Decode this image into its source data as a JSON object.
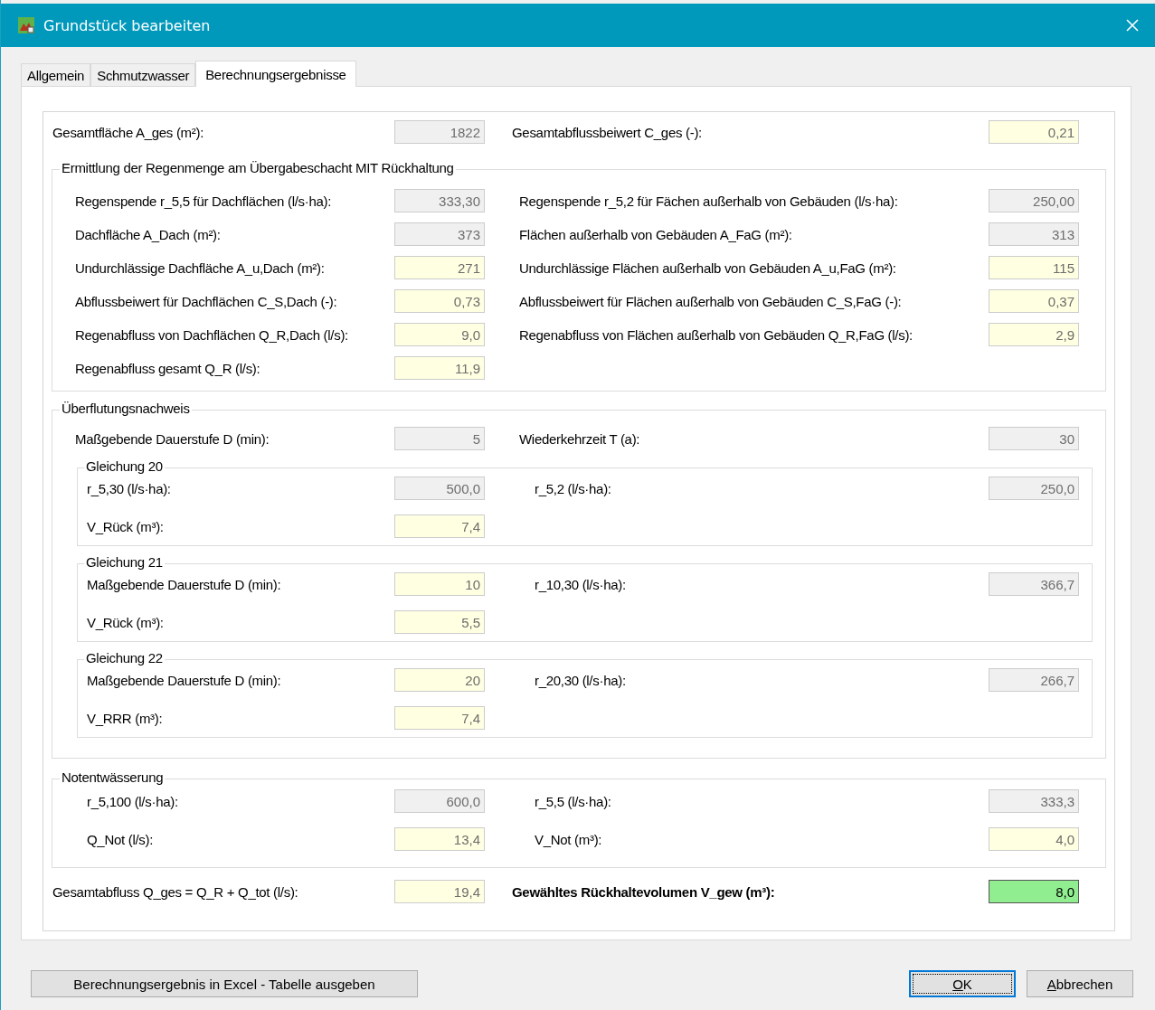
{
  "window": {
    "title": "Grundstück bearbeiten"
  },
  "tabs": [
    {
      "label": "Allgemein",
      "selected": false
    },
    {
      "label": "Schmutzwasser",
      "selected": false
    },
    {
      "label": "Berechnungsergebnisse",
      "selected": true
    }
  ],
  "summary": {
    "left": {
      "label": "Gesamtfläche A_ges (m²):",
      "value": "1822",
      "kind": "readonly"
    },
    "right": {
      "label": "Gesamtabflussbeiwert C_ges (-):",
      "value": "0,21",
      "kind": "computed"
    }
  },
  "rain_section": {
    "title": "Ermittlung der Regenmenge am Übergabeschacht MIT Rückhaltung",
    "rows": [
      {
        "left": {
          "label": "Regenspende r_5,5 für Dachflächen (l/s·ha):",
          "value": "333,30",
          "kind": "readonly"
        },
        "right": {
          "label": "Regenspende r_5,2 für Fächen außerhalb von Gebäuden (l/s·ha):",
          "value": "250,00",
          "kind": "readonly"
        }
      },
      {
        "left": {
          "label": "Dachfläche A_Dach (m²):",
          "value": "373",
          "kind": "readonly"
        },
        "right": {
          "label": "Flächen außerhalb von Gebäuden A_FaG (m²):",
          "value": "313",
          "kind": "readonly"
        }
      },
      {
        "left": {
          "label": "Undurchlässige Dachfläche A_u,Dach (m²):",
          "value": "271",
          "kind": "computed"
        },
        "right": {
          "label": "Undurchlässige Flächen außerhalb von Gebäuden A_u,FaG (m²):",
          "value": "115",
          "kind": "computed"
        }
      },
      {
        "left": {
          "label": "Abflussbeiwert für Dachflächen C_S,Dach (-):",
          "value": "0,73",
          "kind": "computed"
        },
        "right": {
          "label": "Abflussbeiwert für Flächen außerhalb von Gebäuden C_S,FaG (-):",
          "value": "0,37",
          "kind": "computed"
        }
      },
      {
        "left": {
          "label": "Regenabfluss von Dachflächen Q_R,Dach (l/s):",
          "value": "9,0",
          "kind": "computed"
        },
        "right": {
          "label": "Regenabfluss von Flächen außerhalb von Gebäuden Q_R,FaG (l/s):",
          "value": "2,9",
          "kind": "computed"
        }
      },
      {
        "left": {
          "label": "Regenabfluss gesamt Q_R (l/s):",
          "value": "11,9",
          "kind": "computed"
        }
      }
    ]
  },
  "flood_section": {
    "title": "Überflutungsnachweis",
    "top": {
      "left": {
        "label": "Maßgebende Dauerstufe D (min):",
        "value": "5",
        "kind": "readonly"
      },
      "right": {
        "label": "Wiederkehrzeit T (a):",
        "value": "30",
        "kind": "readonly"
      }
    },
    "equations": [
      {
        "title": "Gleichung 20",
        "rows": [
          {
            "left": {
              "label": "r_5,30 (l/s·ha):",
              "value": "500,0",
              "kind": "readonly"
            },
            "right": {
              "label": "r_5,2 (l/s·ha):",
              "value": "250,0",
              "kind": "readonly"
            }
          },
          {
            "left": {
              "label": "V_Rück (m³):",
              "value": "7,4",
              "kind": "computed"
            }
          }
        ]
      },
      {
        "title": "Gleichung 21",
        "rows": [
          {
            "left": {
              "label": "Maßgebende Dauerstufe D (min):",
              "value": "10",
              "kind": "computed"
            },
            "right": {
              "label": "r_10,30 (l/s·ha):",
              "value": "366,7",
              "kind": "readonly"
            }
          },
          {
            "left": {
              "label": "V_Rück (m³):",
              "value": "5,5",
              "kind": "computed"
            }
          }
        ]
      },
      {
        "title": "Gleichung 22",
        "rows": [
          {
            "left": {
              "label": "Maßgebende Dauerstufe D (min):",
              "value": "20",
              "kind": "computed"
            },
            "right": {
              "label": "r_20,30 (l/s·ha):",
              "value": "266,7",
              "kind": "readonly"
            }
          },
          {
            "left": {
              "label": "V_RRR (m³):",
              "value": "7,4",
              "kind": "computed"
            }
          }
        ]
      }
    ]
  },
  "emergency_section": {
    "title": "Notentwässerung",
    "rows": [
      {
        "left": {
          "label": "r_5,100 (l/s·ha):",
          "value": "600,0",
          "kind": "readonly"
        },
        "right": {
          "label": "r_5,5 (l/s·ha):",
          "value": "333,3",
          "kind": "readonly"
        }
      },
      {
        "left": {
          "label": "Q_Not (l/s):",
          "value": "13,4",
          "kind": "computed"
        },
        "right": {
          "label": "V_Not (m³):",
          "value": "4,0",
          "kind": "computed"
        }
      }
    ]
  },
  "total": {
    "left": {
      "label": "Gesamtabfluss Q_ges = Q_R + Q_tot (l/s):",
      "value": "19,4",
      "kind": "computed"
    },
    "right": {
      "label": "Gewähltes Rückhaltevolumen V_gew (m³):",
      "value": "8,0",
      "kind": "highlight",
      "bold": true
    }
  },
  "buttons": [
    {
      "label": "Berechnungsergebnis in Excel - Tabelle ausgeben",
      "kind": "export",
      "underlined": false
    },
    {
      "label": "OK",
      "kind": "default",
      "underlined": true
    },
    {
      "label": "Abbrechen",
      "kind": "cancel",
      "underlined": true
    }
  ]
}
